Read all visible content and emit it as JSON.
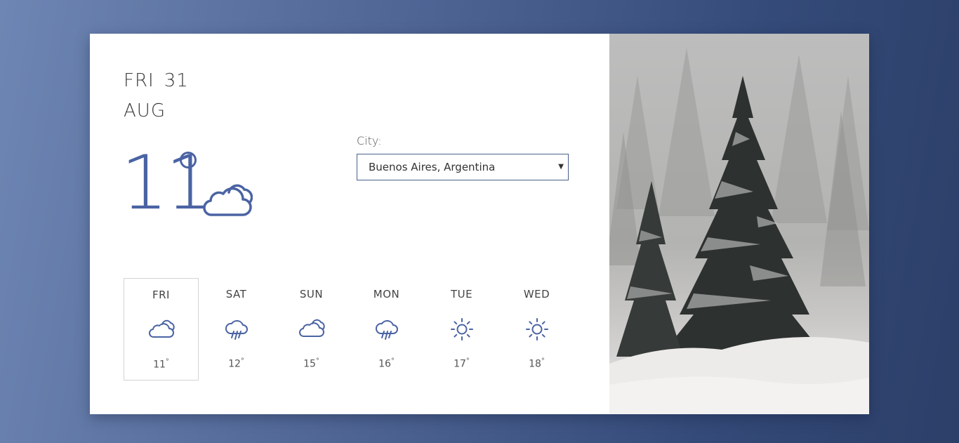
{
  "current": {
    "weekday": "FRI",
    "day": "31",
    "month": "AUG",
    "temperature": "11",
    "condition_icon": "cloud-icon"
  },
  "city": {
    "label": "City:",
    "selected": "Buenos Aires, Argentina"
  },
  "forecast": [
    {
      "day": "FRI",
      "temp": "11",
      "deg": "°",
      "icon": "cloud-icon",
      "active": true
    },
    {
      "day": "SAT",
      "temp": "12",
      "deg": "°",
      "icon": "rain-cloud-icon"
    },
    {
      "day": "SUN",
      "temp": "15",
      "deg": "°",
      "icon": "cloud-icon"
    },
    {
      "day": "MON",
      "temp": "16",
      "deg": "°",
      "icon": "rain-cloud-icon"
    },
    {
      "day": "TUE",
      "temp": "17",
      "deg": "°",
      "icon": "sun-icon"
    },
    {
      "day": "WED",
      "temp": "18",
      "deg": "°",
      "icon": "sun-icon"
    }
  ],
  "colors": {
    "accent": "#4a63a3",
    "background_start": "#6e86b3",
    "background_end": "#2c3f69"
  },
  "image": {
    "subject": "snowy-pine-tree-photo"
  }
}
